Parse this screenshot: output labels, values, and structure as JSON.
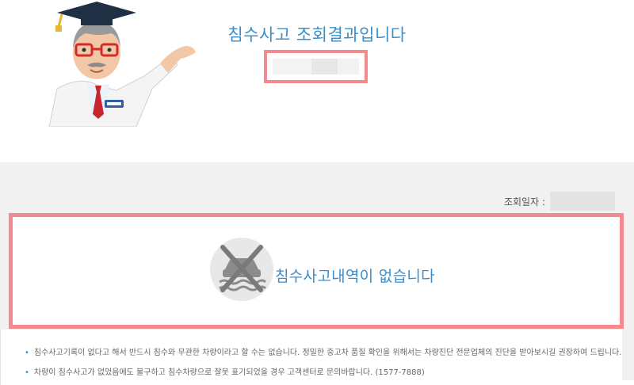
{
  "header": {
    "title": "침수사고 조회결과입니다"
  },
  "inquiry": {
    "date_label": "조회일자 :"
  },
  "result": {
    "message": "침수사고내역이 없습니다"
  },
  "notes": [
    "침수사고기록이 없다고 해서 반드시 침수와 무관한 차량이라고 할 수는 없습니다. 정밀한 중고차 품질 확인을 위해서는 차량진단 전문업체의 진단을 받아보시길 권장하여 드립니다.",
    "차량이 침수사고가 없었음에도 불구하고 침수차량으로 잘못 표기되었을 경우 고객센터로 문의바랍니다. (1577-7888)"
  ],
  "colors": {
    "accent_blue": "#3a8fc8",
    "highlight_pink": "#f38b8e"
  },
  "icons": {
    "mascot": "doctor-mascot",
    "result": "no-flood-car-icon"
  }
}
